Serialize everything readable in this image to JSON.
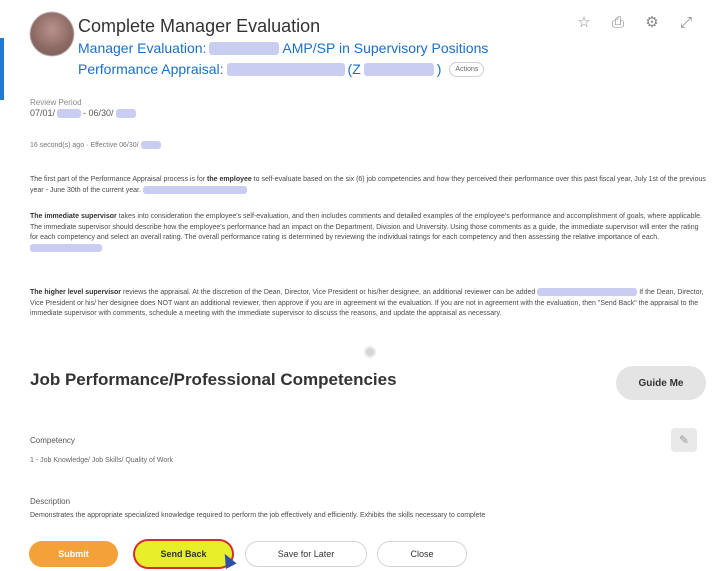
{
  "header": {
    "title": "Complete Manager Evaluation",
    "line1_prefix": "Manager Evaluation:",
    "line1_suffix": "AMP/SP in Supervisory Positions",
    "line2_prefix": "Performance Appraisal:",
    "line2_mid": "(Z",
    "line2_end": ")",
    "actions_label": "Actions"
  },
  "icons": [
    "star-icon",
    "print-icon",
    "gear-icon",
    "expand-icon"
  ],
  "review": {
    "label": "Review Period",
    "start": "07/01/",
    "separator": "- 06/30/"
  },
  "meta": {
    "time_ago": "16 second(s) ago",
    "separator": "·",
    "effective": "Effective 06/30/"
  },
  "paragraphs": {
    "p1_a": "The first part of the Performance Appraisal process is for",
    "p1_b": "the employee",
    "p1_c": "to self-evaluate based on the six (6) job competencies and how they perceived their performance over this past fiscal year, July 1st of the previous year - June 30th of the current year.",
    "p2_a": "The immediate supervisor",
    "p2_b": "takes into consideration the employee's self-evaluation, and then includes comments and detailed examples of the employee's performance and accomplishment of goals, where applicable. The immediate supervisor should describe how the employee's performance had an impact on the Department, Division and University. Using those comments as a guide, the immediate supervisor will enter the rating for each competency and select an overall rating. The overall performance rating is determined by reviewing the individual ratings for each competency and then assessing the relative importance of each.",
    "p3_a": "The higher level supervisor",
    "p3_b": "reviews the appraisal. At the discretion of the Dean, Director, Vice President or his/her designee, an additional reviewer can be added",
    "p3_c": "If the Dean, Director, Vice President or his/ her designee does NOT want an additional reviewer, then approve if you are in agreement wi the evaluation. If you are not in agreement with the evaluation, then \"Send Back\" the appraisal to the immediate supervisor with comments, schedule a meeting with the immediate supervisor to discuss the reasons, and update the appraisal as necessary."
  },
  "section": {
    "title": "Job Performance/Professional Competencies",
    "guide_label": "Guide Me"
  },
  "competency": {
    "label": "Competency",
    "value": "1 - Job Knowledge/ Job Skills/ Quality of Work"
  },
  "description": {
    "label": "Description",
    "text": "Demonstrates the appropriate specialized knowledge required to perform the job effectively and efficiently.  Exhibits the skills necessary to complete"
  },
  "footer": {
    "submit": "Submit",
    "send_back": "Send Back",
    "save_later": "Save for Later",
    "close": "Close"
  },
  "colors": {
    "link_blue": "#1a6fc9",
    "submit_orange": "#f5a13a",
    "highlight_yellow": "#e7ef2b",
    "annotation_red": "#d62d2d"
  }
}
